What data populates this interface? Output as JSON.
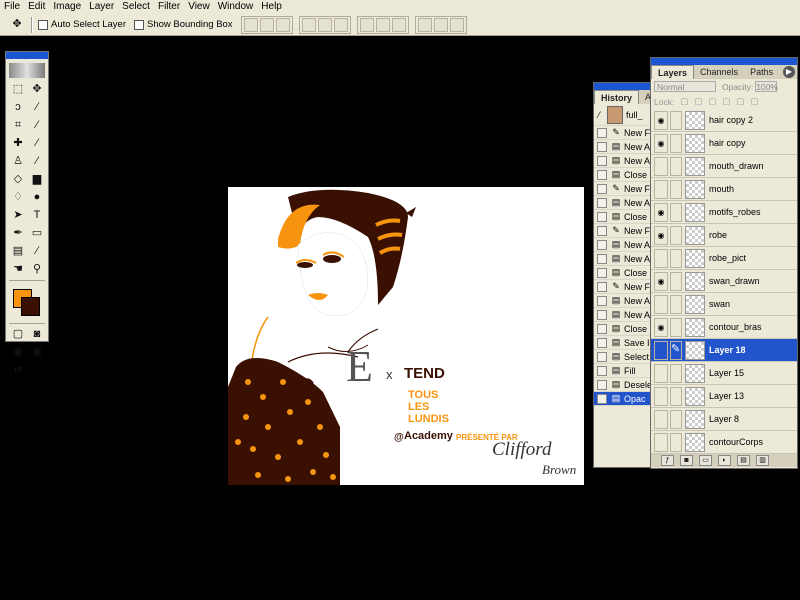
{
  "menu": [
    "File",
    "Edit",
    "Image",
    "Layer",
    "Select",
    "Filter",
    "View",
    "Window",
    "Help"
  ],
  "options": {
    "auto_select_layer": "Auto Select Layer",
    "show_bounding_box": "Show Bounding Box"
  },
  "colors": {
    "foreground": "#f7940f",
    "background": "#3a1003",
    "selection": "#2255cc"
  },
  "artwork": {
    "ex": "E",
    "x": "x",
    "tend": "TEND",
    "tous": "TOUS",
    "les": "LES",
    "lundis": "LUNDIS",
    "at": "@",
    "academy": "Academy",
    "presente": "PRÉSENTÉ PAR",
    "clifford": "Clifford",
    "brown": "Brown"
  },
  "history": {
    "tabs": [
      "History",
      "A"
    ],
    "snapshot": "full_",
    "items": [
      {
        "icon": "brush-icon",
        "label": "New F"
      },
      {
        "icon": "doc-icon",
        "label": "New A"
      },
      {
        "icon": "doc-icon",
        "label": "New A"
      },
      {
        "icon": "doc-icon",
        "label": "Close"
      },
      {
        "icon": "brush-icon",
        "label": "New F"
      },
      {
        "icon": "doc-icon",
        "label": "New A"
      },
      {
        "icon": "doc-icon",
        "label": "Close"
      },
      {
        "icon": "brush-icon",
        "label": "New F"
      },
      {
        "icon": "doc-icon",
        "label": "New A"
      },
      {
        "icon": "doc-icon",
        "label": "New A"
      },
      {
        "icon": "doc-icon",
        "label": "Close"
      },
      {
        "icon": "brush-icon",
        "label": "New F"
      },
      {
        "icon": "doc-icon",
        "label": "New A"
      },
      {
        "icon": "doc-icon",
        "label": "New A"
      },
      {
        "icon": "doc-icon",
        "label": "Close"
      },
      {
        "icon": "doc-icon",
        "label": "Save I"
      },
      {
        "icon": "doc-icon",
        "label": "Select"
      },
      {
        "icon": "doc-icon",
        "label": "Fill"
      },
      {
        "icon": "doc-icon",
        "label": "Desele"
      },
      {
        "icon": "doc-icon",
        "label": "Opac"
      }
    ]
  },
  "layers": {
    "tabs": [
      "Layers",
      "Channels",
      "Paths"
    ],
    "blend_mode": "Normal",
    "opacity_label": "Opacity:",
    "opacity_value": "100%",
    "lock_label": "Lock:",
    "items": [
      {
        "name": "hair copy 2",
        "visible": true
      },
      {
        "name": "hair copy",
        "visible": true
      },
      {
        "name": "mouth_drawn",
        "visible": false
      },
      {
        "name": "mouth",
        "visible": false
      },
      {
        "name": "motifs_robes",
        "visible": true
      },
      {
        "name": "robe",
        "visible": true
      },
      {
        "name": "robe_pict",
        "visible": false
      },
      {
        "name": "swan_drawn",
        "visible": true
      },
      {
        "name": "swan",
        "visible": false
      },
      {
        "name": "contour_bras",
        "visible": true
      },
      {
        "name": "Layer 18",
        "visible": false,
        "selected": true
      },
      {
        "name": "Layer 15",
        "visible": false
      },
      {
        "name": "Layer 13",
        "visible": false
      },
      {
        "name": "Layer 8",
        "visible": false
      },
      {
        "name": "contourCorps",
        "visible": false
      }
    ]
  }
}
